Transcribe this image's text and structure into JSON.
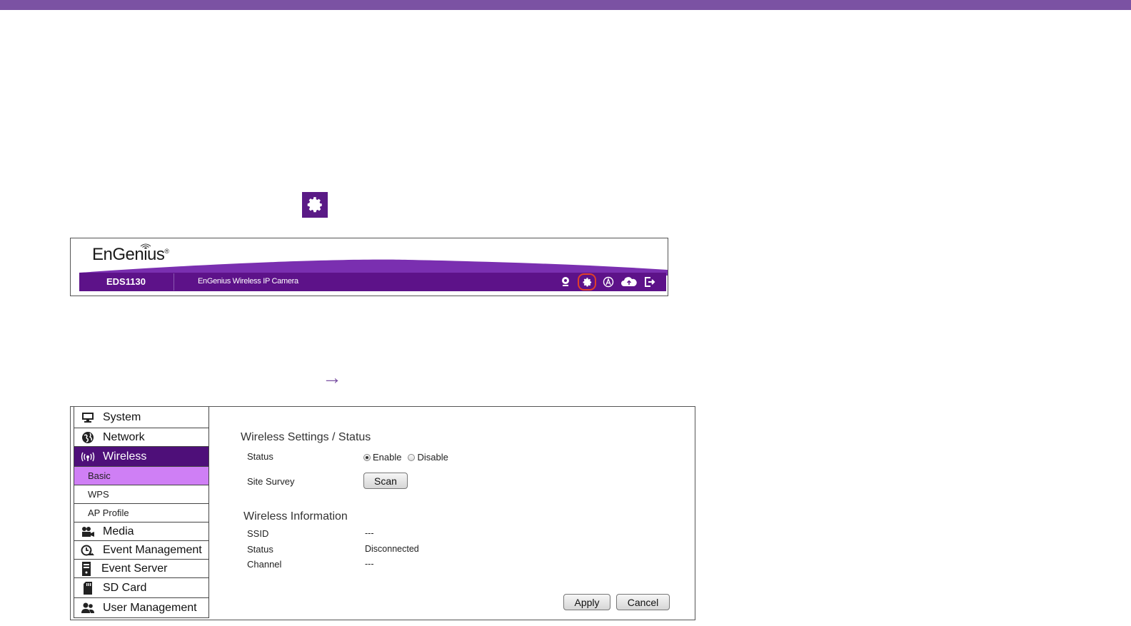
{
  "colors": {
    "accent": "#7b52a3",
    "header_bar": "#5d1289",
    "nav_active": "#4e0f79",
    "nav_sub_active": "#cf7ff5",
    "highlight": "#e0402a"
  },
  "header": {
    "logo": "EnGenius",
    "model": "EDS1130",
    "description": "EnGenius Wireless IP Camera",
    "icons": [
      "camera-icon",
      "gear-icon",
      "account-icon",
      "cloud-upload-icon",
      "logout-icon"
    ]
  },
  "arrow": "→",
  "nav": {
    "items": [
      {
        "label": "System",
        "icon": "monitor-icon"
      },
      {
        "label": "Network",
        "icon": "globe-icon"
      },
      {
        "label": "Wireless",
        "icon": "wireless-icon"
      },
      {
        "label": "Media",
        "icon": "media-icon"
      },
      {
        "label": "Event Management",
        "icon": "event-icon"
      },
      {
        "label": "Event Server",
        "icon": "server-icon"
      },
      {
        "label": "SD Card",
        "icon": "sdcard-icon"
      },
      {
        "label": "User Management",
        "icon": "users-icon"
      }
    ],
    "wireless_sub": [
      "Basic",
      "WPS",
      "AP Profile"
    ]
  },
  "settings": {
    "title": "Wireless Settings / Status",
    "status_label": "Status",
    "enable": "Enable",
    "disable": "Disable",
    "site_survey_label": "Site Survey",
    "scan": "Scan"
  },
  "info": {
    "title": "Wireless Information",
    "ssid_label": "SSID",
    "ssid_value": "---",
    "status_label": "Status",
    "status_value": "Disconnected",
    "channel_label": "Channel",
    "channel_value": "---"
  },
  "actions": {
    "apply": "Apply",
    "cancel": "Cancel"
  }
}
